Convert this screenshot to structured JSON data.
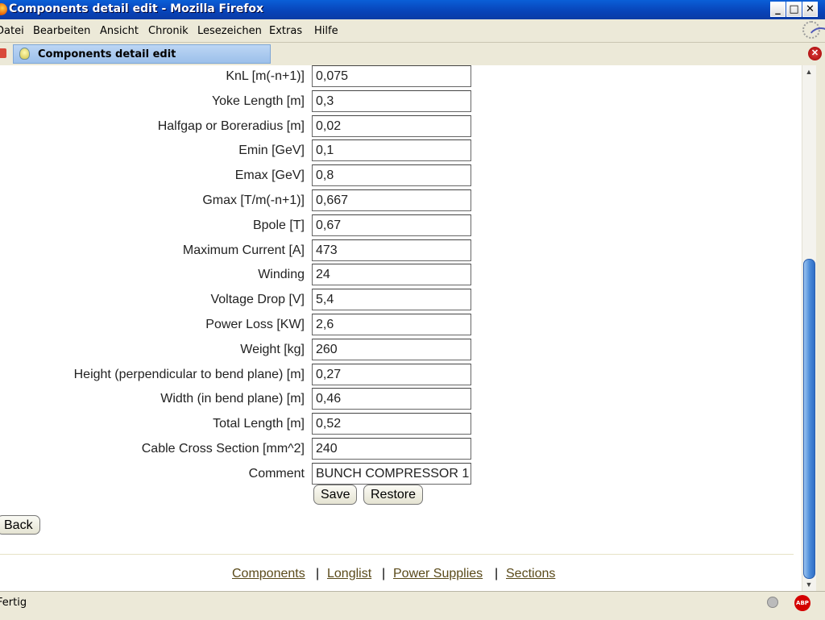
{
  "window": {
    "title": "Components detail edit - Mozilla Firefox",
    "buttons": {
      "minimize": "_",
      "maximize": " ",
      "close": "✕"
    }
  },
  "menu": [
    {
      "label": "Datei"
    },
    {
      "label": "Bearbeiten"
    },
    {
      "label": "Ansicht"
    },
    {
      "label": "Chronik"
    },
    {
      "label": "Lesezeichen"
    },
    {
      "label": "Extras"
    },
    {
      "label": "Hilfe"
    }
  ],
  "tab": {
    "label": "Components detail edit"
  },
  "form": {
    "fields": [
      {
        "label": "KnL [m(-n+1)]",
        "value": "0,075"
      },
      {
        "label": "Yoke Length [m]",
        "value": "0,3"
      },
      {
        "label": "Halfgap or Boreradius [m]",
        "value": "0,02"
      },
      {
        "label": "Emin [GeV]",
        "value": "0,1"
      },
      {
        "label": "Emax [GeV]",
        "value": "0,8"
      },
      {
        "label": "Gmax [T/m(-n+1)]",
        "value": "0,667"
      },
      {
        "label": "Bpole [T]",
        "value": "0,67"
      },
      {
        "label": "Maximum Current [A]",
        "value": "473"
      },
      {
        "label": "Winding",
        "value": "24"
      },
      {
        "label": "Voltage Drop [V]",
        "value": "5,4"
      },
      {
        "label": "Power Loss [KW]",
        "value": "2,6"
      },
      {
        "label": "Weight [kg]",
        "value": "260"
      },
      {
        "label": "Height (perpendicular to bend plane) [m]",
        "value": "0,27"
      },
      {
        "label": "Width (in bend plane) [m]",
        "value": "0,46"
      },
      {
        "label": "Total Length [m]",
        "value": "0,52"
      },
      {
        "label": "Cable Cross Section [mm^2]",
        "value": "240"
      },
      {
        "label": "Comment",
        "value": "BUNCH COMPRESSOR 1"
      }
    ],
    "save_label": "Save",
    "restore_label": "Restore",
    "back_label": "Back"
  },
  "footer": {
    "links": [
      "Components",
      "Longlist",
      "Power Supplies",
      "Sections"
    ],
    "separator": "|"
  },
  "status": {
    "text": "Fertig",
    "adblock": "ABP"
  }
}
